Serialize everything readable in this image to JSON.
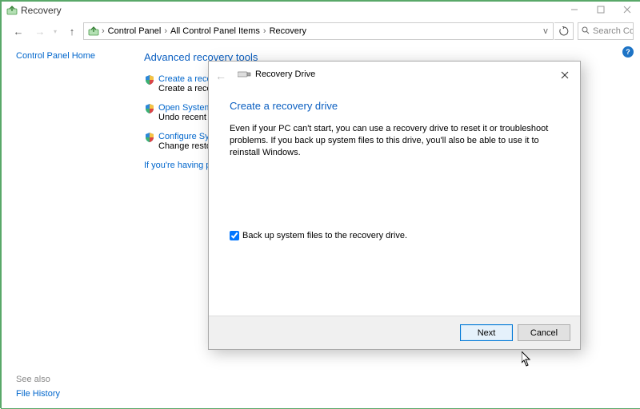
{
  "window": {
    "title": "Recovery",
    "minimize": "—",
    "maximize": "☐",
    "close": "✕"
  },
  "nav": {
    "back": "←",
    "forward": "→",
    "up": "↑"
  },
  "breadcrumb": {
    "items": [
      "Control Panel",
      "All Control Panel Items",
      "Recovery"
    ],
    "dropdown": "v",
    "refresh": "⟳"
  },
  "search": {
    "placeholder": "Search Co...",
    "icon": "⌕"
  },
  "sidebar": {
    "home": "Control Panel Home",
    "see_also_label": "See also",
    "file_history": "File History"
  },
  "main": {
    "heading": "Advanced recovery tools",
    "tools": [
      {
        "link": "Create a recovery drive",
        "desc": "Create a recovery drive to troubleshoot problems when your PC can't start."
      },
      {
        "link": "Open System Restore",
        "desc": "Undo recent system changes, but leave files such as documents, pictures, and music unchanged."
      },
      {
        "link": "Configure System Restore",
        "desc": "Change restore settings, manage disk space, and create or delete restore points."
      }
    ],
    "trouble_link": "If you're having problems with your PC, you can refresh it in PC settings."
  },
  "dialog": {
    "title": "Recovery Drive",
    "back": "←",
    "close": "✕",
    "heading": "Create a recovery drive",
    "body": "Even if your PC can't start, you can use a recovery drive to reset it or troubleshoot problems. If you back up system files to this drive, you'll also be able to use it to reinstall Windows.",
    "checkbox_label": "Back up system files to the recovery drive.",
    "checkbox_checked": true,
    "next": "Next",
    "cancel": "Cancel"
  },
  "help": "?"
}
